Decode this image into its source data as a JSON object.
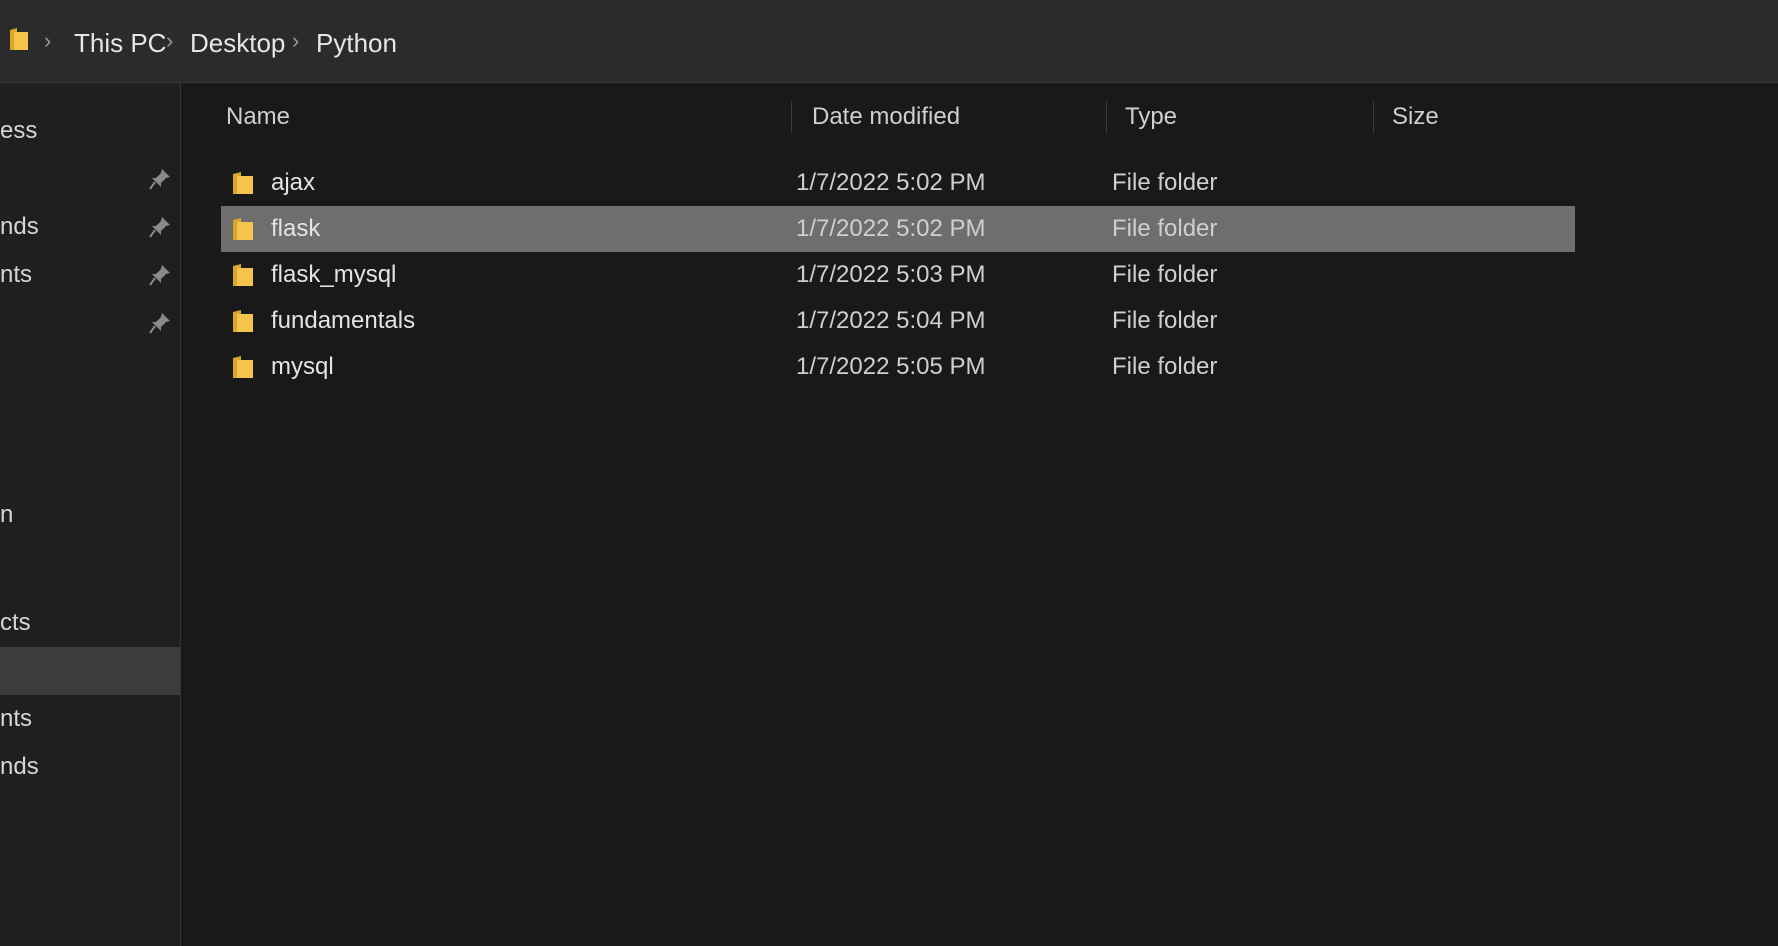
{
  "breadcrumb": {
    "icon": "folder-icon",
    "items": [
      "This PC",
      "Desktop",
      "Python"
    ]
  },
  "sidebar": {
    "items": [
      {
        "label": "ess",
        "pinned": false
      },
      {
        "label": "",
        "pinned": true
      },
      {
        "label": "nds",
        "pinned": true
      },
      {
        "label": "nts",
        "pinned": true
      },
      {
        "label": "",
        "pinned": true
      },
      {
        "label": "n",
        "pinned": false
      },
      {
        "label": "cts",
        "pinned": false
      },
      {
        "label": "",
        "pinned": false,
        "selected": true
      },
      {
        "label": "nts",
        "pinned": false
      },
      {
        "label": "nds",
        "pinned": false
      }
    ]
  },
  "columns": {
    "name": "Name",
    "date": "Date modified",
    "type": "Type",
    "size": "Size"
  },
  "files": [
    {
      "name": "ajax",
      "date": "1/7/2022 5:02 PM",
      "type": "File folder",
      "size": ""
    },
    {
      "name": "flask",
      "date": "1/7/2022 5:02 PM",
      "type": "File folder",
      "size": "",
      "selected": true
    },
    {
      "name": "flask_mysql",
      "date": "1/7/2022 5:03 PM",
      "type": "File folder",
      "size": ""
    },
    {
      "name": "fundamentals",
      "date": "1/7/2022 5:04 PM",
      "type": "File folder",
      "size": ""
    },
    {
      "name": "mysql",
      "date": "1/7/2022 5:05 PM",
      "type": "File folder",
      "size": ""
    }
  ],
  "colors": {
    "folder": "#f4c54a",
    "selection": "#6e6e6e",
    "background": "#191919"
  }
}
